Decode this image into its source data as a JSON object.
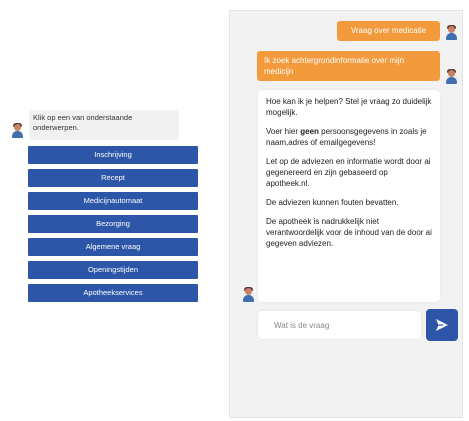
{
  "menu": {
    "intro": "Klik op een van onderstaande onderwerpen.",
    "items": [
      {
        "label": "Inschrijving"
      },
      {
        "label": "Recept"
      },
      {
        "label": "Medicijnautomaat"
      },
      {
        "label": "Bezorging"
      },
      {
        "label": "Algemene vraag"
      },
      {
        "label": "Openingstijden"
      },
      {
        "label": "Apotheekservices"
      }
    ]
  },
  "chat": {
    "user_messages": [
      {
        "text": "Vraag over medicatie"
      },
      {
        "text": "Ik zoek achtergrondinformatie over mijn medicijn"
      }
    ],
    "bot_answer": {
      "p1": "Hoe kan ik je helpen? Stel je vraag zo duidelijk mogelijk.",
      "p2_before": "Voer hier ",
      "p2_bold": "geen",
      "p2_after": " persoonsgegevens in zoals je naam,adres of emailgegevens!",
      "p3": "Let op de adviezen en informatie wordt door ai gegenereerd en zijn gebaseerd op apotheek.nl.",
      "p4": "De adviezen kunnen fouten bevatten.",
      "p5": "De apotheek is nadrukkelijk niet verantwoordelijk voor de inhoud van de door ai gegeven adviezen."
    },
    "input": {
      "placeholder": "Wat is de vraag",
      "value": ""
    },
    "send_icon": "send-arrow-icon"
  },
  "colors": {
    "primary_blue": "#2d56a8",
    "user_orange": "#f39a3c",
    "panel_gray": "#f2f2f2"
  },
  "icons": {
    "avatar": "pharmacist-avatar-icon",
    "user_avatar": "user-avatar-icon"
  }
}
